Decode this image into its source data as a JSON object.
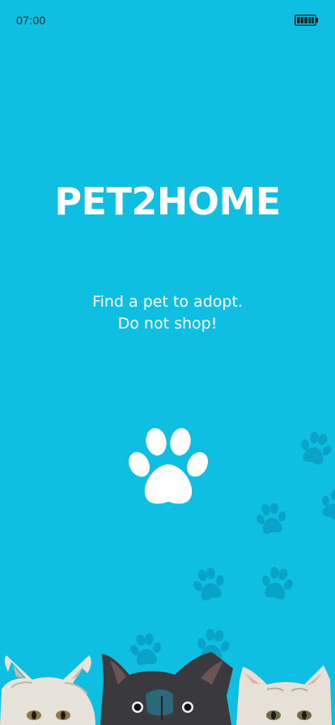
{
  "status_bar": {
    "time": "07:00",
    "battery_icon": "battery-full-icon"
  },
  "app": {
    "title": "PET2HOME",
    "tagline_line1": "Find a pet to adopt.",
    "tagline_line2": "Do not shop!"
  },
  "icons": {
    "main": "paw-icon",
    "background": "paw-print-icon"
  },
  "colors": {
    "background": "#0fbfe2",
    "text": "#ffffff",
    "decor_paw": "#0a9ec4",
    "status_text": "#1a2a33"
  }
}
